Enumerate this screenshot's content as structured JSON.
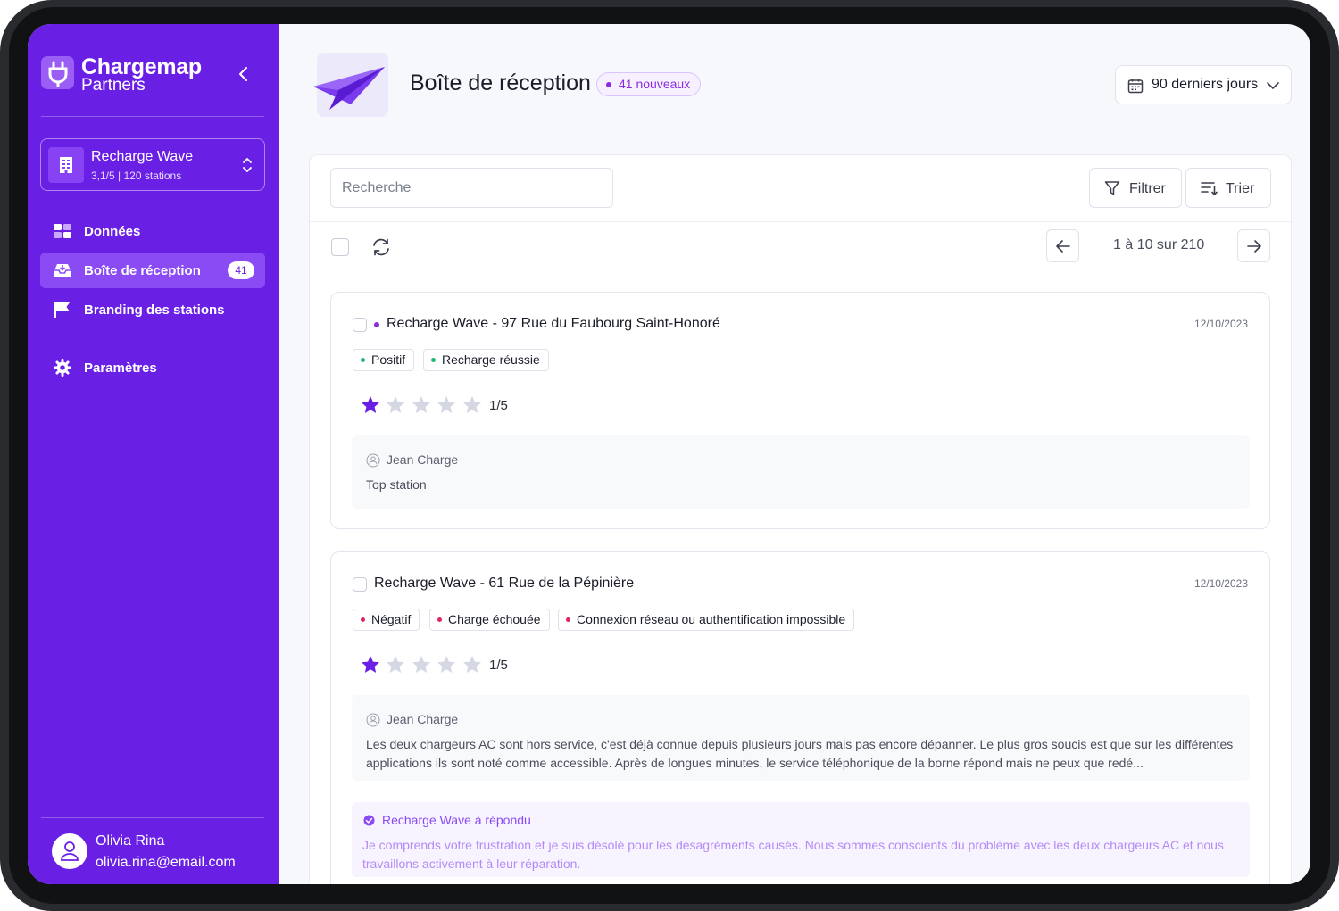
{
  "brand": {
    "name": "Chargemap",
    "sub": "Partners"
  },
  "station": {
    "name": "Recharge Wave",
    "rating": "3,1/5",
    "stations": "120 stations"
  },
  "nav": [
    {
      "label": "Données",
      "icon": "grid-icon"
    },
    {
      "label": "Boîte de réception",
      "icon": "inbox-icon",
      "badge": "41",
      "active": true
    },
    {
      "label": "Branding des stations",
      "icon": "flag-icon"
    },
    {
      "label": "Paramètres",
      "icon": "gear-icon"
    }
  ],
  "user": {
    "name": "Olivia Rina",
    "email": "olivia.rina@email.com"
  },
  "header": {
    "title": "Boîte de réception",
    "badge": "41 nouveaux",
    "date_range": "90 derniers jours"
  },
  "toolbar": {
    "search_placeholder": "Recherche",
    "filter_label": "Filtrer",
    "sort_label": "Trier",
    "pagination": "1 à 10 sur 210"
  },
  "colors": {
    "primary": "#6a1fe5",
    "positive": "#22b573",
    "negative": "#e0245e",
    "star_active": "#6a1fe5",
    "star_inactive": "#d5d8e2"
  },
  "reviews": [
    {
      "title": "Recharge Wave - 97 Rue du Faubourg Saint-Honoré",
      "unread": true,
      "date": "12/10/2023",
      "tags": [
        {
          "label": "Positif",
          "tone": "positive"
        },
        {
          "label": "Recharge réussie",
          "tone": "positive"
        }
      ],
      "rating": 1,
      "rating_text": "1/5",
      "author": "Jean Charge",
      "comment": "Top station"
    },
    {
      "title": "Recharge Wave - 61 Rue de la Pépinière",
      "unread": false,
      "date": "12/10/2023",
      "tags": [
        {
          "label": "Négatif",
          "tone": "negative"
        },
        {
          "label": "Charge échouée",
          "tone": "negative"
        },
        {
          "label": "Connexion réseau ou authentification impossible",
          "tone": "negative"
        }
      ],
      "rating": 1,
      "rating_text": "1/5",
      "author": "Jean Charge",
      "comment": "Les deux chargeurs AC sont hors service, c'est déjà connue depuis plusieurs jours mais pas encore dépanner. Le plus gros soucis est que sur les différentes applications ils sont noté comme accessible. Après de longues minutes, le service téléphonique de la borne répond mais ne peux que redé...",
      "reply_head": "Recharge Wave à répondu",
      "reply": "Je comprends votre frustration et je suis désolé pour les désagréments causés. Nous sommes conscients du problème avec les deux chargeurs AC et nous travaillons activement à leur réparation."
    }
  ]
}
